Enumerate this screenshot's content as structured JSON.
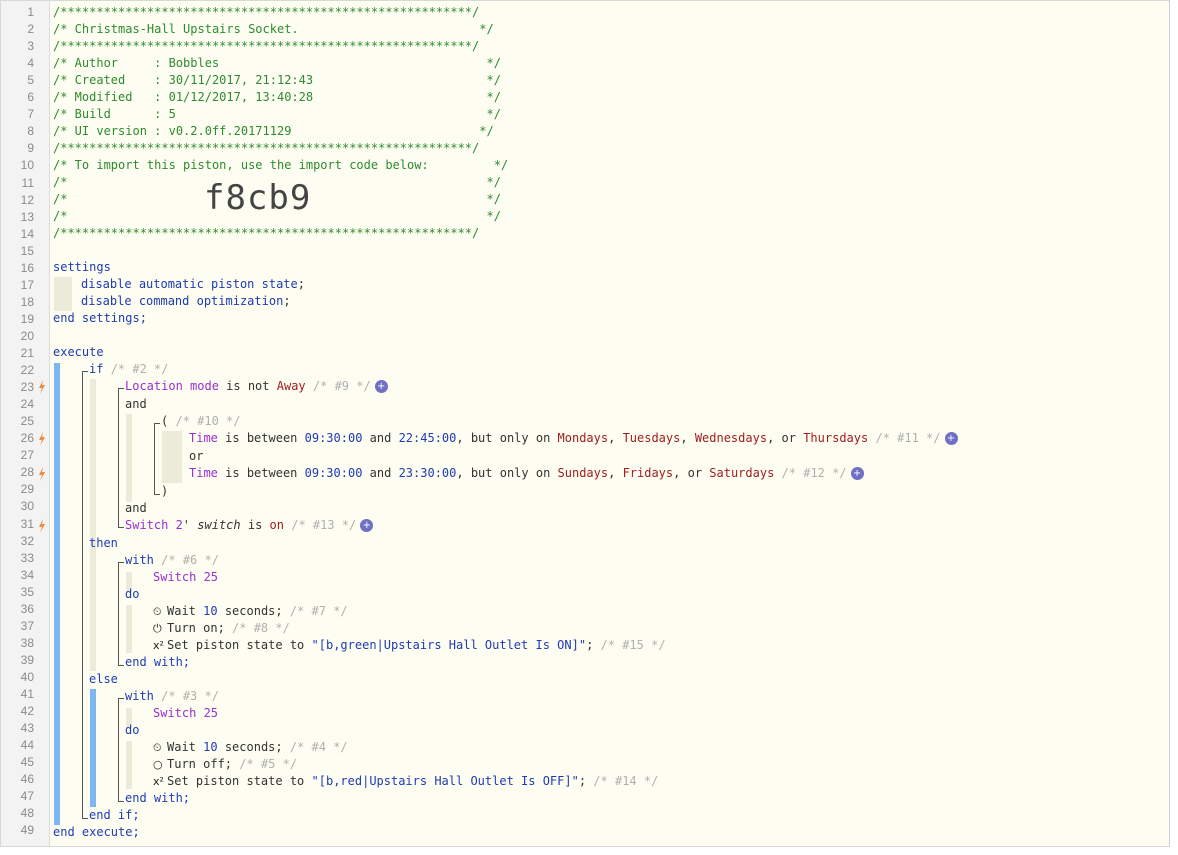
{
  "header": {
    "stars": "/*********************************************************/",
    "title": "/* Christmas-Hall Upstairs Socket.                         */",
    "author": "/* Author     : Bobbles                                     */",
    "created": "/* Created    : 30/11/2017, 21:12:43                        */",
    "modified": "/* Modified   : 01/12/2017, 13:40:28                        */",
    "build": "/* Build      : 5                                           */",
    "ui_version": "/* UI version : v0.2.0ff.20171129                          */",
    "import_msg": "/* To import this piston, use the import code below:         */",
    "blank": "/*                                                          */",
    "import_code": "f8cb9"
  },
  "line_numbers": [
    "1",
    "2",
    "3",
    "4",
    "5",
    "6",
    "7",
    "8",
    "9",
    "10",
    "11",
    "12",
    "13",
    "14",
    "15",
    "16",
    "17",
    "18",
    "19",
    "20",
    "21",
    "22",
    "23",
    "24",
    "25",
    "26",
    "27",
    "28",
    "29",
    "30",
    "31",
    "32",
    "33",
    "34",
    "35",
    "36",
    "37",
    "38",
    "39",
    "40",
    "41",
    "42",
    "43",
    "44",
    "45",
    "46",
    "47",
    "48",
    "49"
  ],
  "settings": {
    "open": "settings",
    "s1_a": "disable",
    "s1_b": "automatic piston state",
    "s2_a": "disable",
    "s2_b": "command optimization",
    "close": "end settings;"
  },
  "execute": {
    "open": "execute",
    "close": "end execute;",
    "if_kw": "if",
    "if_cm": "/* #2 */",
    "c1_dev": "Location mode",
    "c1_op": "is not",
    "c1_val": "Away",
    "c1_cm": "/* #9 */",
    "and1": "and",
    "paren_open": "(",
    "paren_cm": "/* #10 */",
    "c2_dev": "Time",
    "c2_op": "is between",
    "c2_from": "09:30:00",
    "c2_and": "and",
    "c2_to": "22:45:00",
    "c2_only": ", but only on",
    "c2_d1": "Mondays",
    "c2_d2": "Tuesdays",
    "c2_d3": "Wednesdays",
    "c2_or": ", or",
    "c2_d4": "Thursdays",
    "c2_cm": "/* #11 */",
    "or": "or",
    "c3_dev": "Time",
    "c3_op": "is between",
    "c3_from": "09:30:00",
    "c3_and": "and",
    "c3_to": "23:30:00",
    "c3_only": ", but only on",
    "c3_d1": "Sundays",
    "c3_d2": "Fridays",
    "c3_or": ", or",
    "c3_d3": "Saturdays",
    "c3_cm": "/* #12 */",
    "paren_close": ")",
    "and2": "and",
    "c4_dev": "Switch 2",
    "c4_apos": "'",
    "c4_attr": "switch",
    "c4_op": "is",
    "c4_val": "on",
    "c4_cm": "/* #13 */",
    "then": "then",
    "with1": "with",
    "with1_cm": "/* #6 */",
    "dev1": "Switch 25",
    "do1": "do",
    "wait1_a": "Wait",
    "wait1_n": "10",
    "wait1_b": "seconds;",
    "wait1_cm": "/* #7 */",
    "on_a": "Turn on;",
    "on_cm": "/* #8 */",
    "set1_a": "Set piston state to",
    "set1_s": "\"[b,green|Upstairs Hall Outlet Is ON]\"",
    "set1_semi": ";",
    "set1_cm": "/* #15 */",
    "endwith1": "end with;",
    "else": "else",
    "with2": "with",
    "with2_cm": "/* #3 */",
    "dev2": "Switch 25",
    "do2": "do",
    "wait2_a": "Wait",
    "wait2_n": "10",
    "wait2_b": "seconds;",
    "wait2_cm": "/* #4 */",
    "off_a": "Turn off;",
    "off_cm": "/* #5 */",
    "set2_a": "Set piston state to",
    "set2_s": "\"[b,red|Upstairs Hall Outlet Is OFF]\"",
    "set2_semi": ";",
    "set2_cm": "/* #14 */",
    "endwith2": "end with;",
    "endif": "end if;"
  },
  "colors": {
    "comment": "#2e8b2e",
    "keyword": "#1f3bb3",
    "device": "#9b2fd0",
    "value": "#a11d1d",
    "bar": "#7cb7f0",
    "plus": "#6f6fc4"
  },
  "icons": {
    "bolt": "lightning-bolt-icon",
    "plus": "add-plus-icon",
    "wait": "clock-icon",
    "on": "power-icon",
    "off": "power-off-icon",
    "set": "superscript-x-icon"
  }
}
